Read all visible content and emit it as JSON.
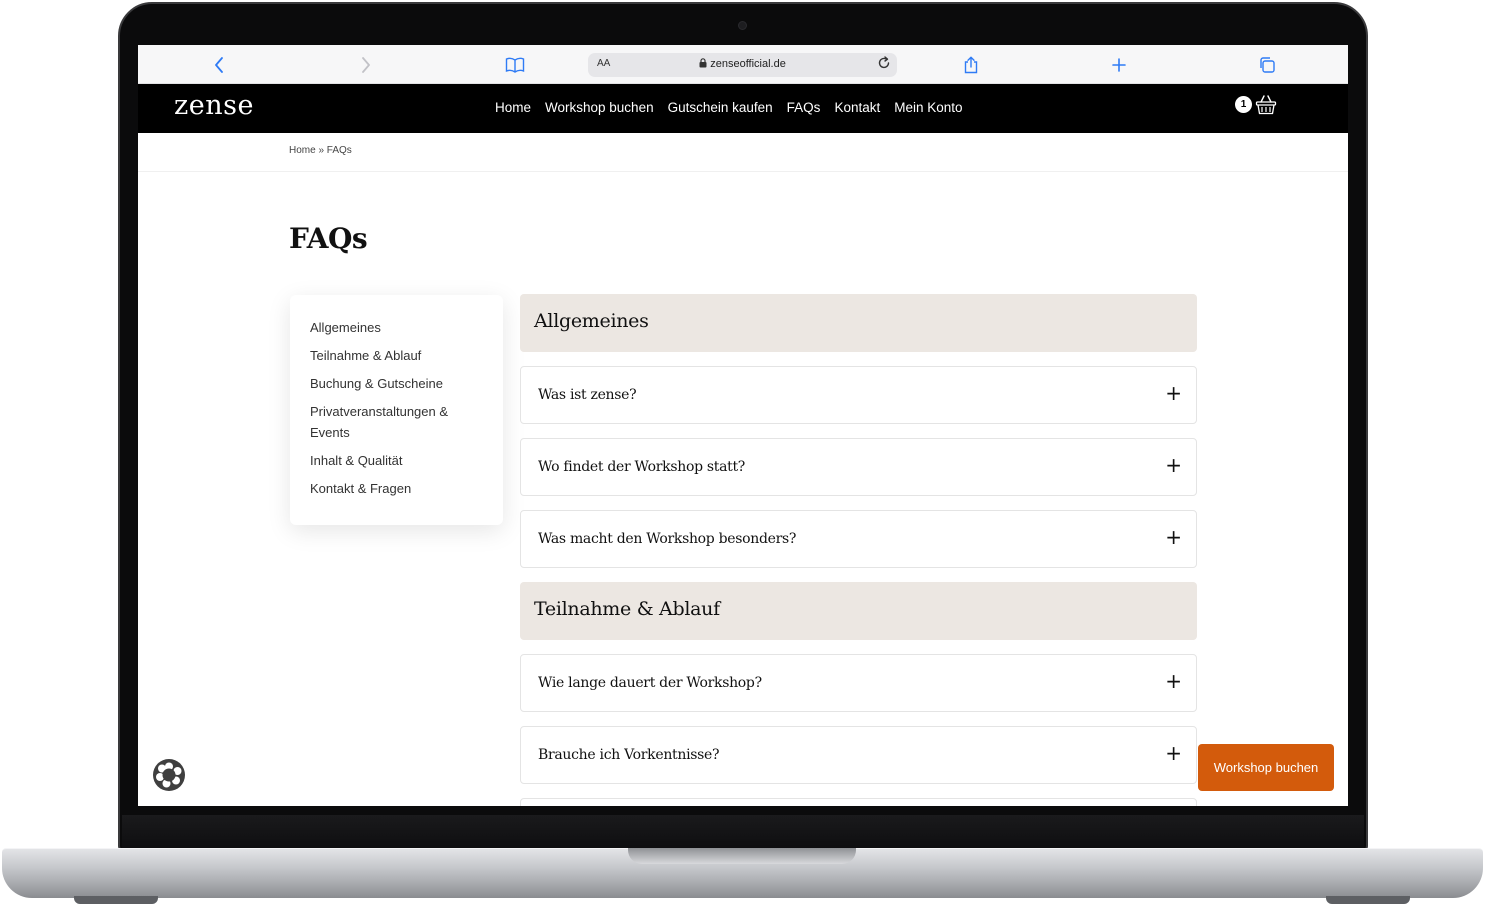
{
  "browser": {
    "aa_label": "AA",
    "url": "zenseofficial.de",
    "icons": [
      "back-icon",
      "forward-icon",
      "bookmarks-icon",
      "share-icon",
      "new-tab-icon",
      "tabs-icon",
      "lock-icon",
      "reload-icon"
    ]
  },
  "site": {
    "logo": "zense",
    "nav": [
      "Home",
      "Workshop buchen",
      "Gutschein kaufen",
      "FAQs",
      "Kontakt",
      "Mein Konto"
    ],
    "cart_count": "1"
  },
  "breadcrumb": "Home » FAQs",
  "page_title": "FAQs",
  "sidebar": [
    "Allgemeines",
    "Teilnahme & Ablauf",
    "Buchung & Gutscheine",
    "Privatveranstaltungen & Events",
    "Inhalt & Qualität",
    "Kontakt & Fragen"
  ],
  "faq": {
    "sections": [
      {
        "title": "Allgemeines",
        "questions": [
          "Was ist zense?",
          "Wo findet der Workshop statt?",
          "Was macht den Workshop besonders?"
        ]
      },
      {
        "title": "Teilnahme & Ablauf",
        "questions": [
          "Wie lange dauert der Workshop?",
          "Brauche ich Vorkentnisse?"
        ]
      }
    ],
    "expand_symbol": "+"
  },
  "cta_button": "Workshop buchen",
  "colors": {
    "header_bg": "#000000",
    "category_bg": "#ece7e2",
    "cta": "#d35b0c",
    "browser_accent": "#2f7bf5"
  }
}
